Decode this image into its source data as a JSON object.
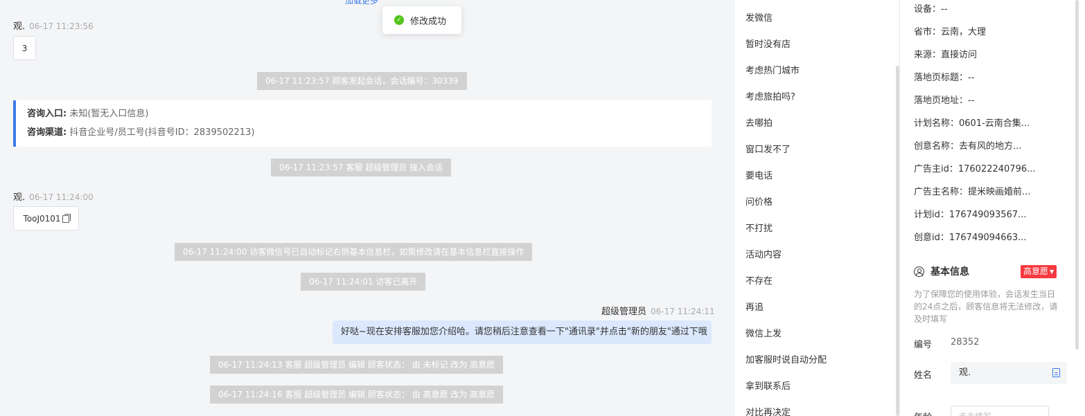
{
  "chat": {
    "load_more": "加载更多",
    "toast": "修改成功",
    "messages": [
      {
        "sender": "观.",
        "time": "06-17 11:23:56",
        "content": "3"
      },
      {
        "sender": "观.",
        "time": "06-17 11:24:00",
        "content": "TooJ0101"
      }
    ],
    "system": [
      "06-17 11:23:57 顾客发起会话，会话编号：30339",
      "06-17 11:23:57 客服 超级管理员 接入会话",
      "06-17 11:24:00 访客微信号已自动标记右侧基本信息栏，如需修改请在基本信息栏直接操作",
      "06-17 11:24:01 访客已离开",
      "06-17 11:24:13 客服 超级管理员 编辑 顾客状态： 由 未标记 改为 高意愿",
      "06-17 11:24:16 客服 超级管理员 编辑 顾客状态： 由 高意愿 改为 高意愿"
    ],
    "info_card": {
      "entry_label": "咨询入口:",
      "entry_value": "未知(暂无入口信息)",
      "channel_label": "咨询渠道:",
      "channel_value": "抖音企业号/员工号(抖音号ID：2839502213)"
    },
    "agent": {
      "name": "超级管理员",
      "time": "06-17 11:24:11",
      "text": "好哒~现在安排客服加您介绍哈。请您稍后注意查看一下\"通讯录\"并点击\"新的朋友\"通过下哦"
    }
  },
  "quick_replies": [
    "发微信",
    "暂时没有店",
    "考虑热门城市",
    "考虑旅拍吗?",
    "去哪拍",
    "窗口发不了",
    "要电话",
    "问价格",
    "不打扰",
    "活动内容",
    "不存在",
    "再追",
    "微信上发",
    "加客服时说自动分配",
    "拿到联系后",
    "对比再决定"
  ],
  "panel": {
    "rows": [
      "设备：--",
      "省市：云南，大理",
      "来源：直接访问",
      "落地页标题：--",
      "落地页地址：--",
      "计划名称：0601-云南合集...",
      "创意名称：去有风的地方...",
      "广告主id：176022240796...",
      "广告主名称：提米映画婚前...",
      "计划id：176749093567...",
      "创意id：176749094663..."
    ],
    "section_title": "基本信息",
    "intent_tag": "高意愿",
    "note": "为了保障您的使用体验，会话发生当日的24点之后，顾客信息将无法修改，请及时填写",
    "id_label": "编号",
    "id_value": "28352",
    "name_label": "姓名",
    "name_value": "观.",
    "age_label": "年龄",
    "age_placeholder": "点击填写"
  },
  "colors": {
    "accent": "#3c7be8",
    "tag": "#f5393f",
    "success": "#52c41a",
    "agent_bubble": "#dbe8fd",
    "system_bg": "#d2d2d2"
  }
}
